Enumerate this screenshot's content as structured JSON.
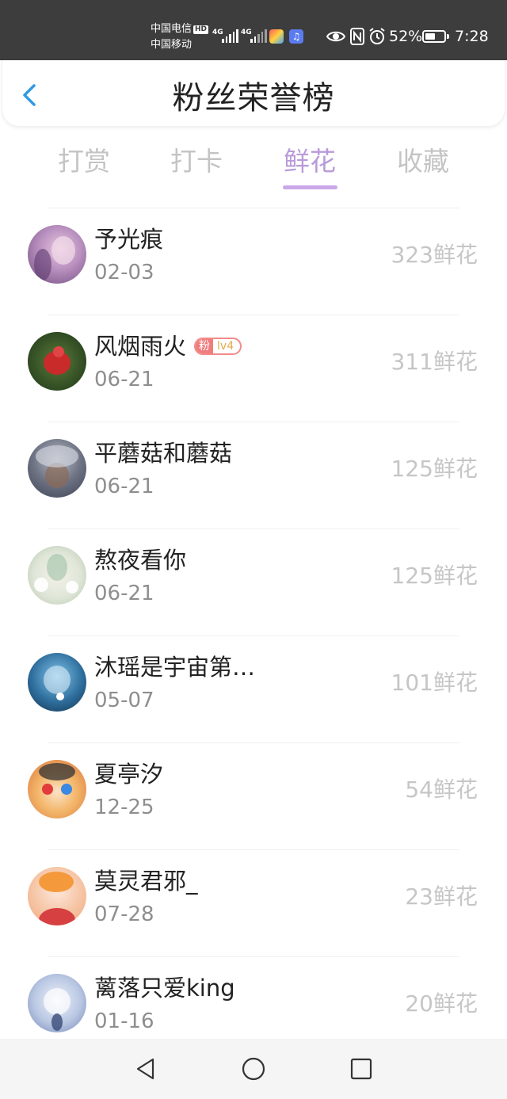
{
  "status_bar": {
    "carrier_1": "中国电信",
    "hd_badge": "HD",
    "carrier_2": "中国移动",
    "network_1": "4G",
    "network_2": "4G",
    "battery_percent": "52%",
    "battery_level": 0.52,
    "time": "7:28",
    "icons": [
      "eye-icon",
      "nfc-icon",
      "alarm-icon",
      "battery-icon"
    ]
  },
  "header": {
    "back_icon": "chevron-left-icon",
    "title": "粉丝荣誉榜"
  },
  "tabs": [
    {
      "label": "打赏",
      "active": false
    },
    {
      "label": "打卡",
      "active": false
    },
    {
      "label": "鲜花",
      "active": true
    },
    {
      "label": "收藏",
      "active": false
    }
  ],
  "fans": [
    {
      "name": "予光痕",
      "date": "02-03",
      "count": "323鲜花"
    },
    {
      "name": "风烟雨火",
      "date": "06-21",
      "count": "311鲜花",
      "badge": {
        "fan": "粉",
        "level": "lv4"
      }
    },
    {
      "name": "平蘑菇和蘑菇",
      "date": "06-21",
      "count": "125鲜花"
    },
    {
      "name": "熬夜看你",
      "date": "06-21",
      "count": "125鲜花"
    },
    {
      "name": "沐瑶是宇宙第…",
      "date": "05-07",
      "count": "101鲜花"
    },
    {
      "name": "夏亭汐",
      "date": "12-25",
      "count": "54鲜花"
    },
    {
      "name": "莫灵君邪_",
      "date": "07-28",
      "count": "23鲜花"
    },
    {
      "name": "蓠落只爱king",
      "date": "01-16",
      "count": "20鲜花"
    }
  ],
  "nav_bar": {
    "icons": [
      "back-triangle-icon",
      "home-circle-icon",
      "recents-square-icon"
    ]
  },
  "colors": {
    "accent": "#b99ad9",
    "underline": "#c9a8e8",
    "back_arrow": "#2f9be6",
    "status_bar_bg": "#3d3d3d"
  }
}
